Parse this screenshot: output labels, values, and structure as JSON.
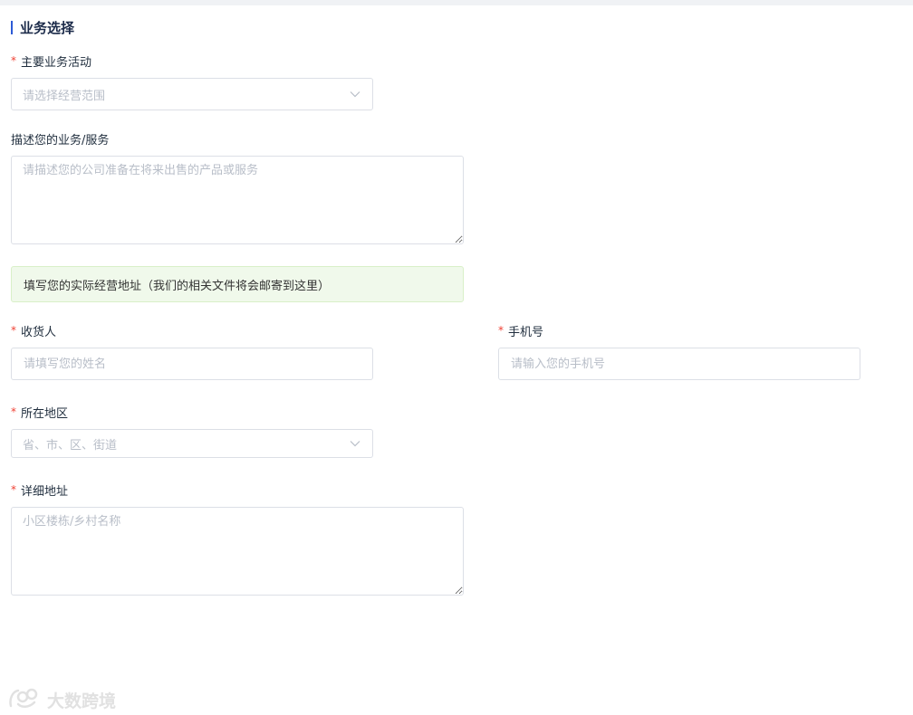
{
  "section": {
    "title": "业务选择"
  },
  "main_activity": {
    "label": "主要业务活动",
    "required_mark": "*",
    "placeholder": "请选择经营范围"
  },
  "description": {
    "label": "描述您的业务/服务",
    "placeholder": "请描述您的公司准备在将来出售的产品或服务"
  },
  "notice": {
    "text": "填写您的实际经营地址（我们的相关文件将会邮寄到这里）"
  },
  "recipient": {
    "label": "收货人",
    "required_mark": "*",
    "placeholder": "请填写您的姓名"
  },
  "phone": {
    "label": "手机号",
    "required_mark": "*",
    "placeholder": "请输入您的手机号"
  },
  "region": {
    "label": "所在地区",
    "required_mark": "*",
    "placeholder": "省、市、区、街道"
  },
  "address": {
    "label": "详细地址",
    "required_mark": "*",
    "placeholder": "小区楼栋/乡村名称"
  },
  "watermark": {
    "text": "大数跨境"
  },
  "colors": {
    "accent": "#2d5bd6",
    "required": "#f04134",
    "notice_bg": "#f0f9eb",
    "placeholder": "#b8bec8",
    "border": "#dcdfe6"
  }
}
